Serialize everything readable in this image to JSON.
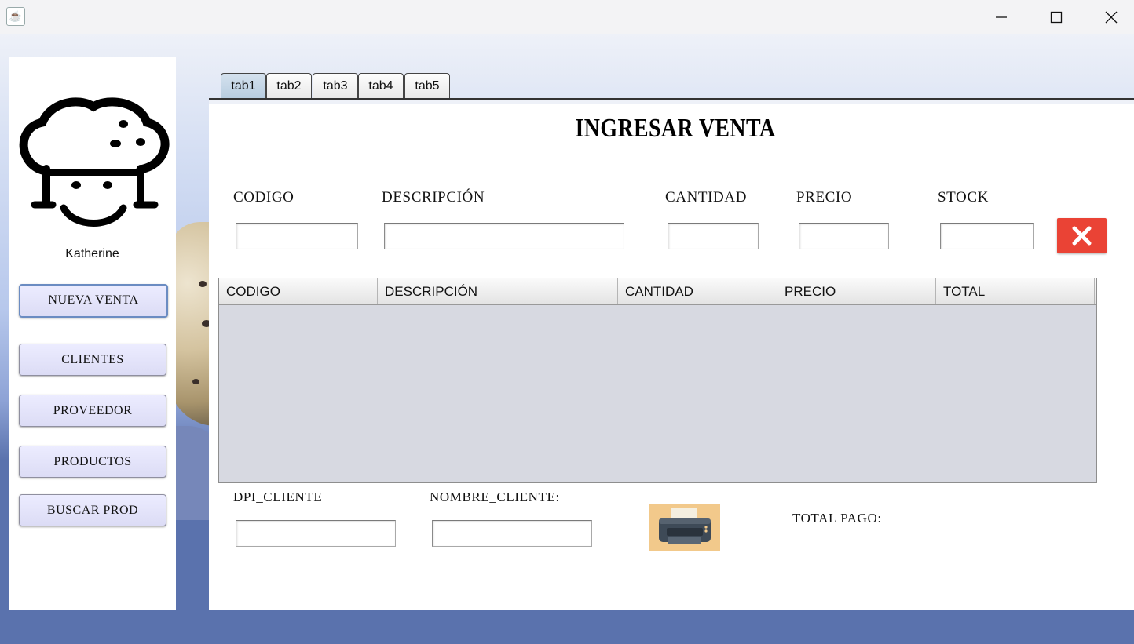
{
  "window": {
    "app_icon": "java-coffee-icon",
    "controls": [
      "minimize-icon",
      "maximize-icon",
      "close-icon"
    ]
  },
  "sidebar": {
    "username": "Katherine",
    "buttons": [
      "NUEVA VENTA",
      "CLIENTES",
      "PROVEEDOR",
      "PRODUCTOS",
      "BUSCAR PROD"
    ],
    "active": "NUEVA VENTA"
  },
  "tabs": [
    "tab1",
    "tab2",
    "tab3",
    "tab4",
    "tab5"
  ],
  "active_tab": "tab1",
  "form": {
    "title": "INGRESAR VENTA",
    "fields": {
      "codigo": {
        "label": "CODIGO",
        "value": ""
      },
      "descripcion": {
        "label": "DESCRIPCIÓN",
        "value": ""
      },
      "cantidad": {
        "label": "CANTIDAD",
        "value": ""
      },
      "precio": {
        "label": "PRECIO",
        "value": ""
      },
      "stock": {
        "label": "STOCK",
        "value": ""
      }
    },
    "table": {
      "columns": [
        "CODIGO",
        "DESCRIPCIÓN",
        "CANTIDAD",
        "PRECIO",
        "TOTAL"
      ],
      "rows": []
    },
    "customer": {
      "dpi_label": "DPI_CLIENTE",
      "dpi_value": "",
      "name_label": "NOMBRE_CLIENTE:",
      "name_value": ""
    },
    "total_label": "TOTAL PAGO:",
    "total_value": ""
  },
  "colors": {
    "accent": "#ea4335",
    "button_bg": "#dcdcf5",
    "table_bg": "#d7d9e1",
    "printer_bg": "#f2c98b"
  }
}
